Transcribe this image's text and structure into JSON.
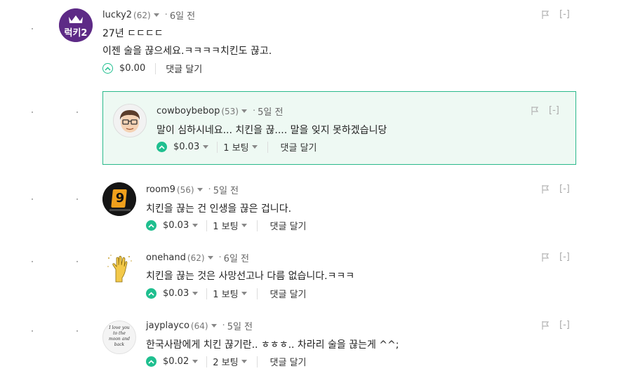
{
  "comments": [
    {
      "author": "lucky2",
      "rep": "(62)",
      "time": "6일 전",
      "lines": [
        "27년 ㄷㄷㄷㄷ",
        "이젠 술을 끊으세요.ㅋㅋㅋㅋ치킨도 끊고."
      ],
      "amount": "$0.00",
      "votes": "",
      "reply": "댓글 달기",
      "avatar_text": "럭키2"
    },
    {
      "author": "cowboybebop",
      "rep": "(53)",
      "time": "5일 전",
      "lines": [
        "말이 심하시네요... 치킨을 끊.... 말을 잊지 못하겠습니당"
      ],
      "amount": "$0.03",
      "votes": "1 보팅",
      "reply": "댓글 달기"
    },
    {
      "author": "room9",
      "rep": "(56)",
      "time": "5일 전",
      "lines": [
        "치킨을 끊는 건 인생을 끊은 겁니다."
      ],
      "amount": "$0.03",
      "votes": "1 보팅",
      "reply": "댓글 달기",
      "avatar_text": "9"
    },
    {
      "author": "onehand",
      "rep": "(62)",
      "time": "6일 전",
      "lines": [
        "치킨을 끊는 것은 사망선고나 다름 없습니다.ㅋㅋㅋ"
      ],
      "amount": "$0.03",
      "votes": "1 보팅",
      "reply": "댓글 달기"
    },
    {
      "author": "jayplayco",
      "rep": "(64)",
      "time": "5일 전",
      "lines": [
        "한국사람에게 치킨 끊기란.. ㅎㅎㅎ.. 차라리 술을 끊는게 ^^;"
      ],
      "amount": "$0.02",
      "votes": "2 보팅",
      "reply": "댓글 달기",
      "avatar_text": "I love you to the moon and back"
    }
  ],
  "meta": {
    "flag_icon": "flag-icon",
    "collapse_label": "[-]",
    "accent_color": "#1fbf8f",
    "highlight_border": "#2ab98b",
    "highlight_bg": "#eef9f3"
  }
}
